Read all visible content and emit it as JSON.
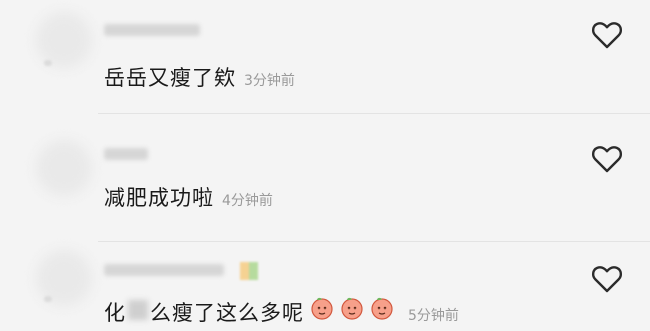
{
  "comments": [
    {
      "user": "",
      "text": "岳岳又瘦了欸",
      "time": "3分钟前"
    },
    {
      "user": "",
      "text": "减肥成功啦",
      "time": "4分钟前"
    },
    {
      "user": "",
      "text_prefix": "化",
      "text_suffix": "么瘦了这么多呢",
      "time": "5分钟前",
      "emojis": [
        "peach-face-icon",
        "peach-face-icon",
        "peach-face-icon"
      ]
    }
  ],
  "icons": {
    "like": "heart-outline-icon"
  },
  "colors": {
    "background": "#f4f4f4",
    "text": "#1f1f1f",
    "time": "#9a9a9a",
    "heart": "#2b2b2b"
  }
}
